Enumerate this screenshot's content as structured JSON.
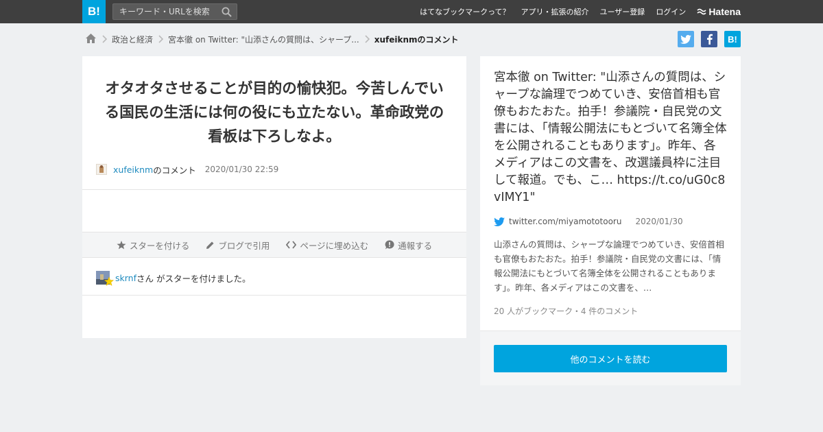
{
  "header": {
    "logo_text": "B!",
    "search_placeholder": "キーワード・URLを検索",
    "nav": [
      "はてなブックマークって？",
      "アプリ・拡張の紹介",
      "ユーザー登録",
      "ログイン"
    ],
    "brand": "Hatena"
  },
  "breadcrumb": {
    "items": [
      "政治と経済",
      "宮本徹 on Twitter: \"山添さんの質問は、シャープ...",
      "xufeiknmのコメント"
    ]
  },
  "share": {
    "twitter_color": "#55acee",
    "facebook_color": "#3b5998",
    "hatena_color": "#00a4de",
    "hatena_label": "B!"
  },
  "comment": {
    "text": "オタオタさせることが目的の愉快犯。今苦しんでいる国民の生活には何の役にも立たない。革命政党の看板は下ろしなよ。",
    "user": "xufeiknm",
    "suffix": "のコメント",
    "date": "2020/01/30 22:59"
  },
  "actions": {
    "star": "スターを付ける",
    "blog": "ブログで引用",
    "embed": "ページに埋め込む",
    "report": "通報する"
  },
  "star_notice": {
    "user": "skrnf",
    "text": "さん がスターを付けました。"
  },
  "entry": {
    "title": "宮本徹 on Twitter: \"山添さんの質問は、シャープな論理でつめていき、安倍首相も官僚もおたおた。拍手！参議院・自民党の文書には、「情報公開法にもとづいて名簿全体を公開されることもあります」。昨年、各メディアはこの文書を、改選議員枠に注目して報道。でも、こ… https://t.co/uG0c8vIMY1\"",
    "domain": "twitter.com/miyamototooru",
    "date": "2020/01/30",
    "summary": "山添さんの質問は、シャープな論理でつめていき、安倍首相も官僚もおたおた。拍手！参議院・自民党の文書には、「情報公開法にもとづいて名簿全体を公開されることもあります」。昨年、各メディアはこの文書を、…",
    "counts": "20 人がブックマーク・4 件のコメント",
    "read_more": "他のコメントを読む"
  },
  "colors": {
    "accent": "#00a4de",
    "header_bg": "#3f3f3f",
    "link": "#1f8bbf"
  }
}
